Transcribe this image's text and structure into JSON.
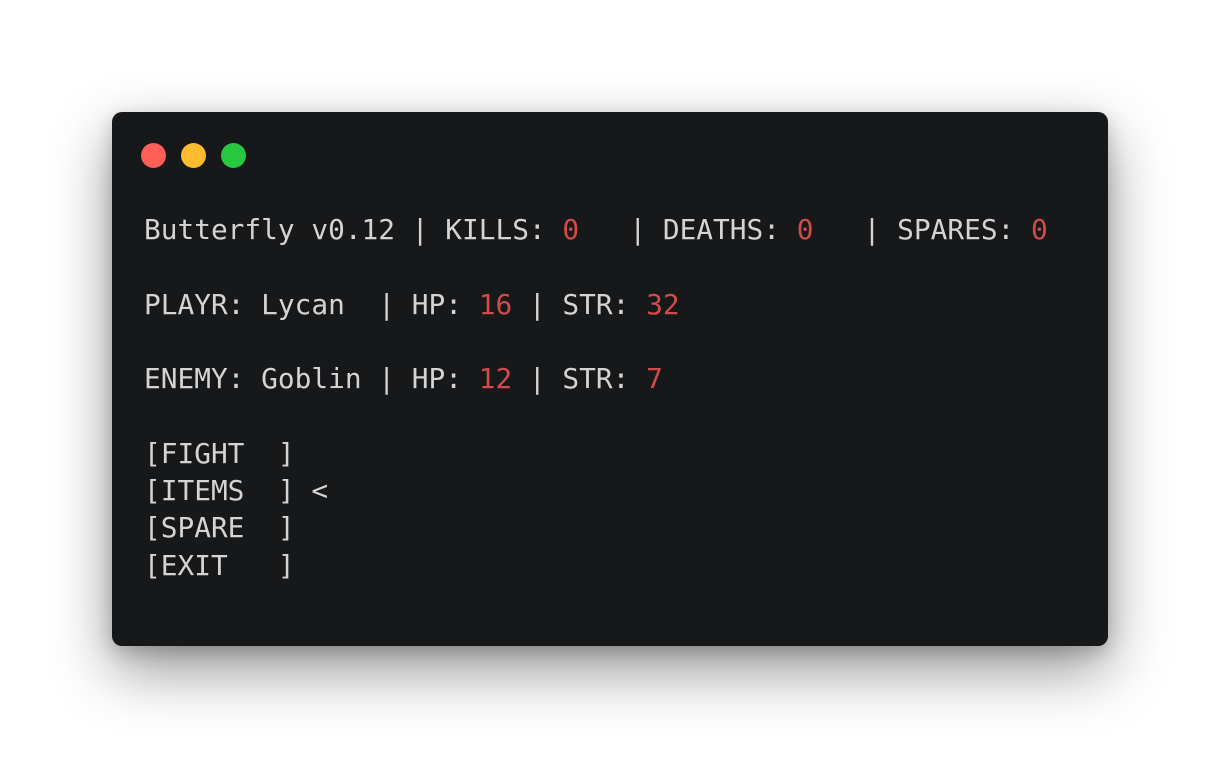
{
  "window": {
    "controls": {
      "close_color": "#fe5f57",
      "minimize_color": "#febc2e",
      "zoom_color": "#28c840"
    }
  },
  "colors": {
    "text": "#d4d4d4",
    "number": "#d14b4b",
    "background": "#17181a"
  },
  "status": {
    "app": "Butterfly v0.12",
    "sep": " | ",
    "kills_label": "KILLS: ",
    "kills": "0",
    "deaths_label": "   | DEATHS: ",
    "deaths": "0",
    "spares_label": "   | SPARES: ",
    "spares": "0"
  },
  "player": {
    "label": "PLAYR: Lycan  | HP: ",
    "hp": "16",
    "str_label": " | STR: ",
    "str": "32"
  },
  "enemy": {
    "label": "ENEMY: Goblin | HP: ",
    "hp": "12",
    "str_label": " | STR: ",
    "str": "7"
  },
  "menu": {
    "fight": "[FIGHT  ]",
    "items": "[ITEMS  ] <",
    "spare": "[SPARE  ]",
    "exit": "[EXIT   ]"
  }
}
